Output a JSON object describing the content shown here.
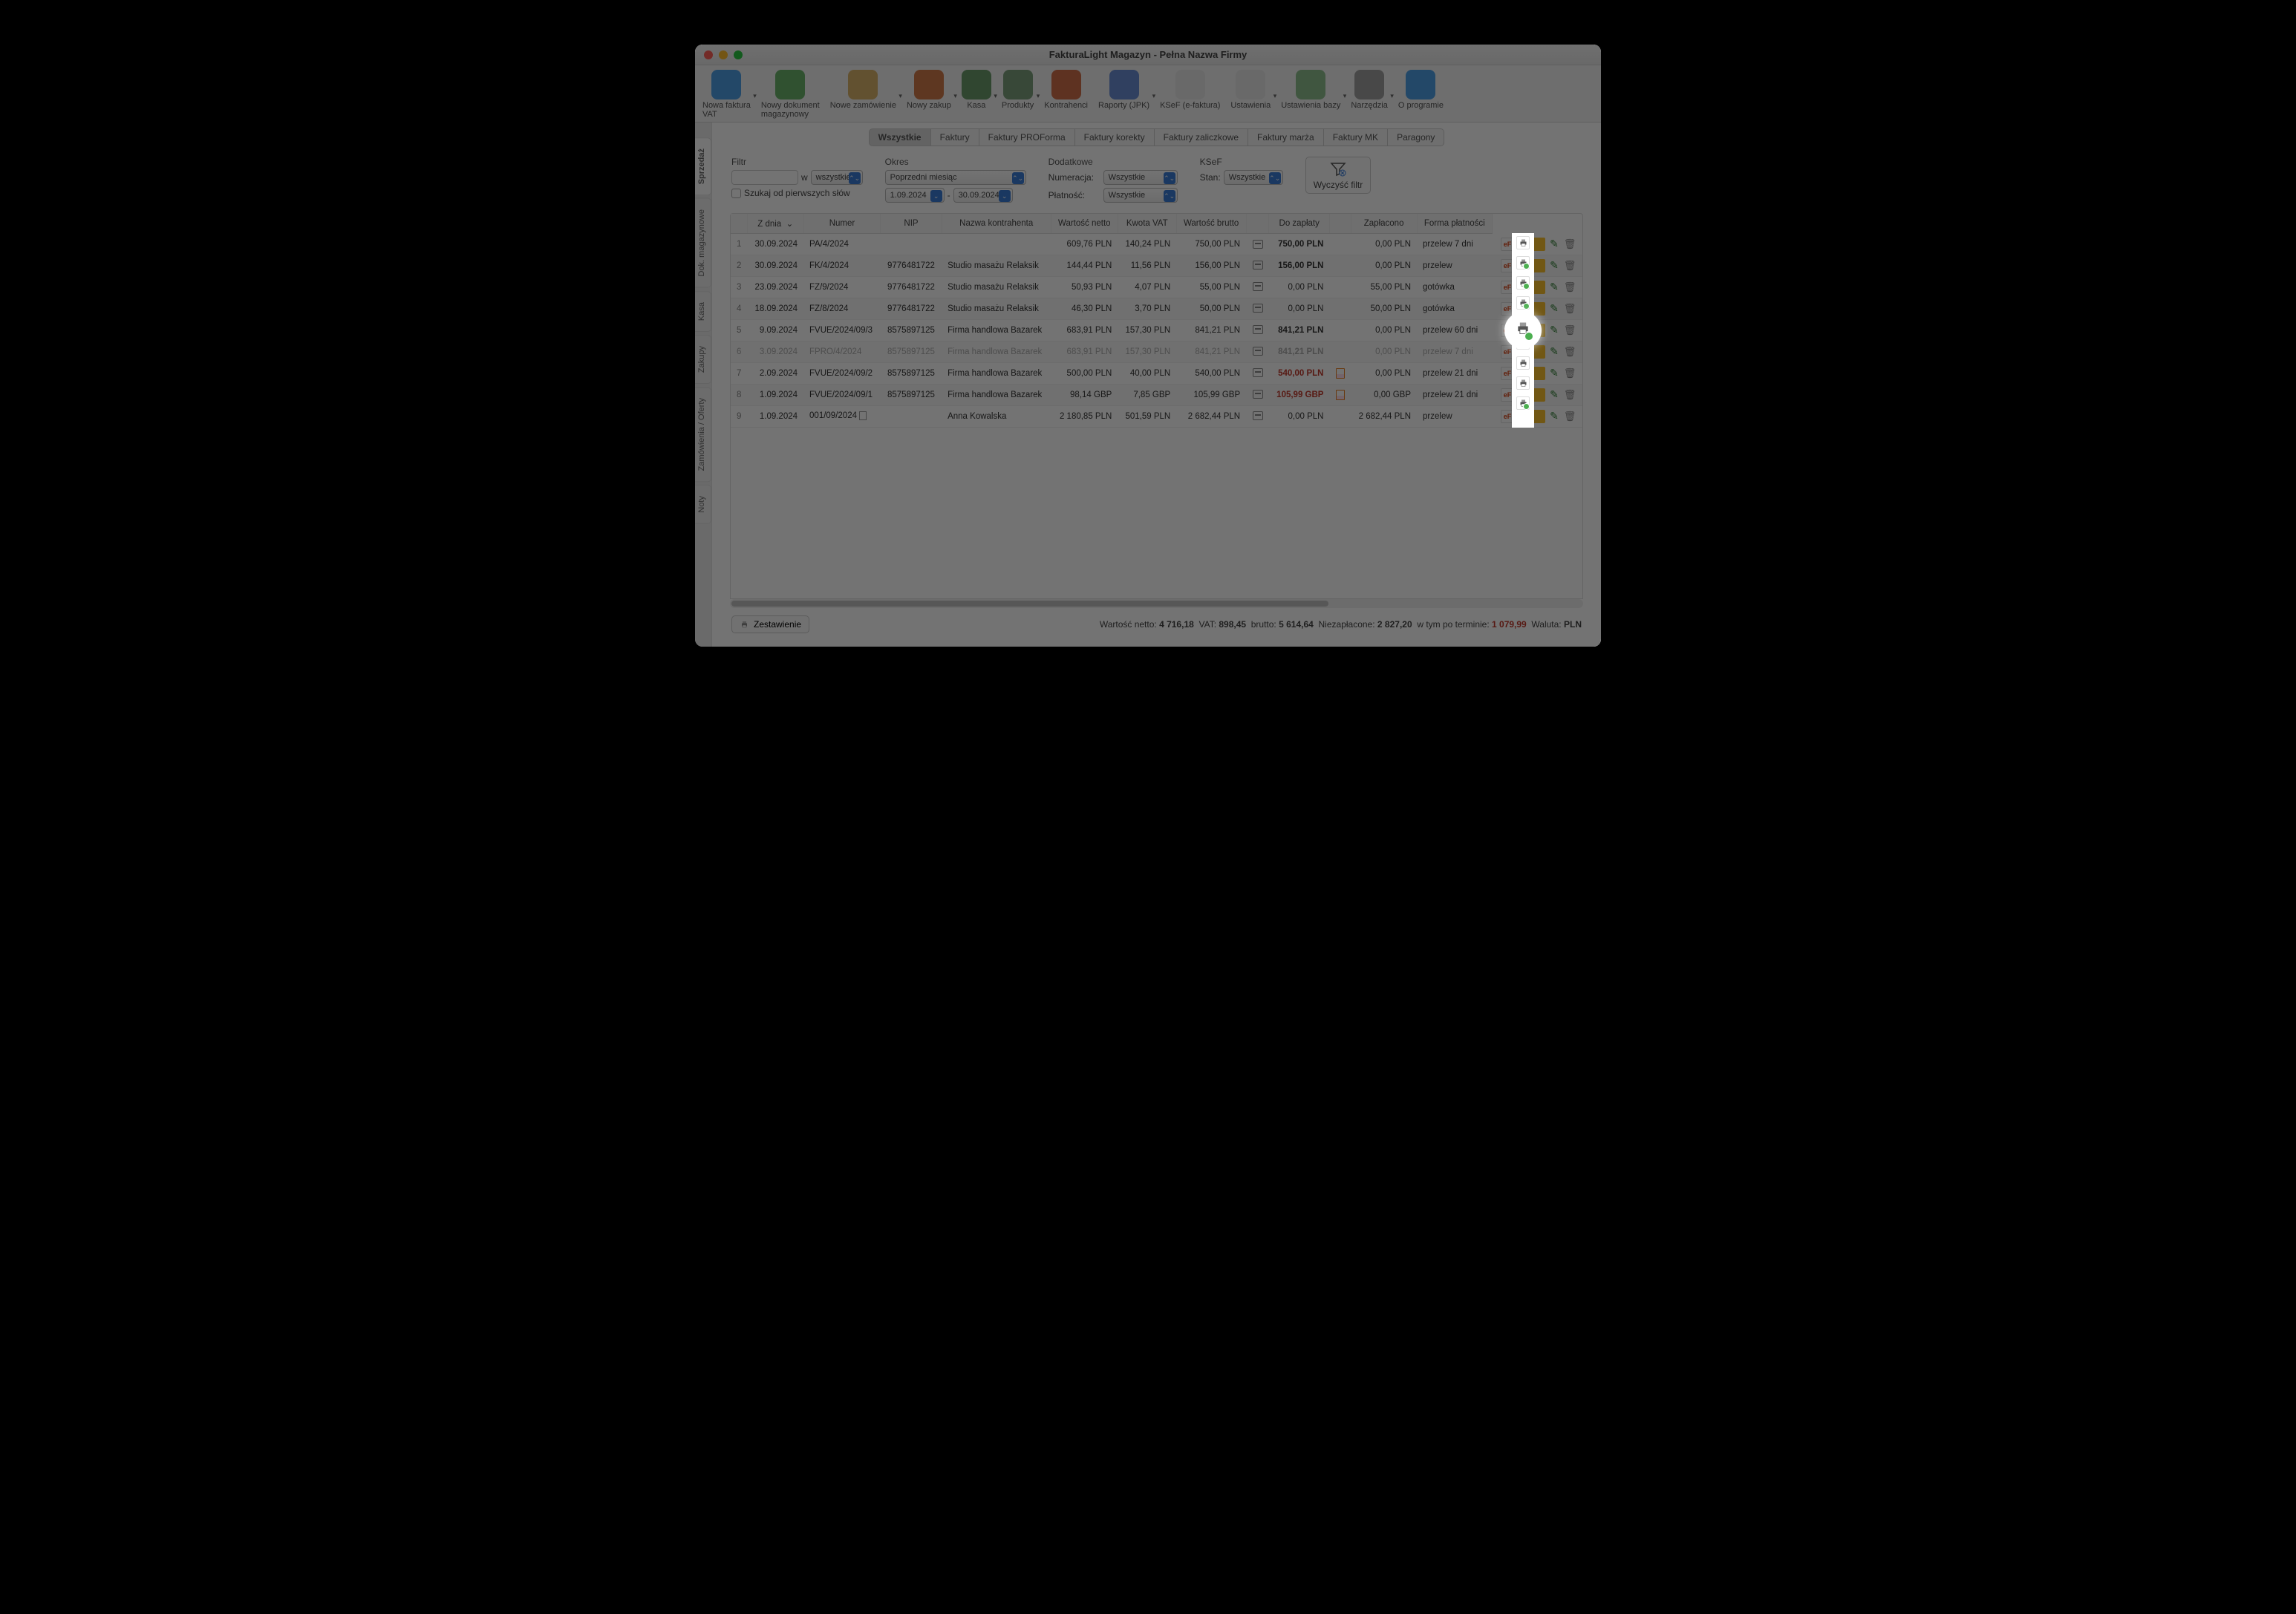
{
  "window_title": "FakturaLight Magazyn - Pełna Nazwa Firmy",
  "toolbar": [
    {
      "label": "Nowa faktura VAT",
      "icon": "#4e9fe6",
      "caret": true
    },
    {
      "label": "Nowy dokument magazynowy",
      "icon": "#6bb36b",
      "caret": false
    },
    {
      "label": "Nowe zamówienie",
      "icon": "#d9b36a",
      "caret": true
    },
    {
      "label": "Nowy zakup",
      "icon": "#d07a4a",
      "caret": true
    },
    {
      "label": "Kasa",
      "icon": "#6b9b6b",
      "caret": true
    },
    {
      "label": "Produkty",
      "icon": "#7da07d",
      "caret": true
    },
    {
      "label": "Kontrahenci",
      "icon": "#d0704a",
      "caret": false
    },
    {
      "label": "Raporty (JPK)",
      "icon": "#6b8fd6",
      "caret": true
    },
    {
      "label": "KSeF (e-faktura)",
      "icon": "#e8e8e8",
      "caret": false
    },
    {
      "label": "Ustawienia",
      "icon": "#e8e8e8",
      "caret": true
    },
    {
      "label": "Ustawienia bazy",
      "icon": "#8fbf8f",
      "caret": true
    },
    {
      "label": "Narzędzia",
      "icon": "#a0a0a0",
      "caret": true
    },
    {
      "label": "O programie",
      "icon": "#4ea0e6",
      "caret": false
    }
  ],
  "sidetabs": [
    "Sprzedaż",
    "Dok. magazynowe",
    "Kasa",
    "Zakupy",
    "Zamówienia / Oferty",
    "Noty"
  ],
  "subtabs": [
    "Wszystkie",
    "Faktury",
    "Faktury PROForma",
    "Faktury korekty",
    "Faktury zaliczkowe",
    "Faktury marża",
    "Faktury MK",
    "Paragony"
  ],
  "filters": {
    "filtr_head": "Filtr",
    "w": "w",
    "w_value": "wszystkie",
    "checkbox_label": "Szukaj od pierwszych słów",
    "okres_head": "Okres",
    "okres_value": "Poprzedni miesiąc",
    "date_from": "1.09.2024",
    "date_sep": "-",
    "date_to": "30.09.2024",
    "dodatkowe_head": "Dodatkowe",
    "numeracja_label": "Numeracja:",
    "numeracja_value": "Wszystkie",
    "platnosc_label": "Płatność:",
    "platnosc_value": "Wszystkie",
    "ksef_head": "KSeF",
    "stan_label": "Stan:",
    "stan_value": "Wszystkie",
    "clear_label": "Wyczyść filtr"
  },
  "columns": [
    "",
    "Z dnia",
    "Numer",
    "NIP",
    "Nazwa kontrahenta",
    "Wartość netto",
    "Kwota VAT",
    "Wartość brutto",
    "",
    "Do zapłaty",
    "",
    "Zapłacono",
    "Forma płatności"
  ],
  "rows": [
    {
      "n": "1",
      "date": "30.09.2024",
      "num": "PA/4/2024",
      "nip": "",
      "name": "",
      "netto": "609,76 PLN",
      "vat": "140,24 PLN",
      "brutto": "750,00 PLN",
      "pi": true,
      "due": "750,00 PLN",
      "due_style": "bold",
      "doc": false,
      "paid": "0,00 PLN",
      "method": "przelew 7 dni",
      "print_ok": false
    },
    {
      "n": "2",
      "date": "30.09.2024",
      "num": "FK/4/2024",
      "nip": "9776481722",
      "name": "Studio masażu Relaksik",
      "netto": "144,44 PLN",
      "vat": "11,56 PLN",
      "brutto": "156,00 PLN",
      "pi": true,
      "due": "156,00 PLN",
      "due_style": "bold",
      "doc": false,
      "paid": "0,00 PLN",
      "method": "przelew",
      "print_ok": true
    },
    {
      "n": "3",
      "date": "23.09.2024",
      "num": "FZ/9/2024",
      "nip": "9776481722",
      "name": "Studio masażu Relaksik",
      "netto": "50,93 PLN",
      "vat": "4,07 PLN",
      "brutto": "55,00 PLN",
      "pi": true,
      "due": "0,00 PLN",
      "due_style": "",
      "doc": false,
      "paid": "55,00 PLN",
      "method": "gotówka",
      "print_ok": true
    },
    {
      "n": "4",
      "date": "18.09.2024",
      "num": "FZ/8/2024",
      "nip": "9776481722",
      "name": "Studio masażu Relaksik",
      "netto": "46,30 PLN",
      "vat": "3,70 PLN",
      "brutto": "50,00 PLN",
      "pi": true,
      "due": "0,00 PLN",
      "due_style": "",
      "doc": false,
      "paid": "50,00 PLN",
      "method": "gotówka",
      "print_ok": true
    },
    {
      "n": "5",
      "date": "9.09.2024",
      "num": "FVUE/2024/09/3",
      "nip": "8575897125",
      "name": "Firma handlowa Bazarek",
      "netto": "683,91 PLN",
      "vat": "157,30 PLN",
      "brutto": "841,21 PLN",
      "pi": true,
      "due": "841,21 PLN",
      "due_style": "bold",
      "doc": false,
      "paid": "0,00 PLN",
      "method": "przelew 60 dni",
      "print_ok": true,
      "highlight": true
    },
    {
      "n": "6",
      "date": "3.09.2024",
      "num": "FPRO/4/2024",
      "nip": "8575897125",
      "name": "Firma handlowa Bazarek",
      "netto": "683,91 PLN",
      "vat": "157,30 PLN",
      "brutto": "841,21 PLN",
      "pi": true,
      "due": "841,21 PLN",
      "due_style": "red",
      "doc": false,
      "paid": "0,00 PLN",
      "method": "przelew 7 dni",
      "dim": true,
      "print_ok": false
    },
    {
      "n": "7",
      "date": "2.09.2024",
      "num": "FVUE/2024/09/2",
      "nip": "8575897125",
      "name": "Firma handlowa Bazarek",
      "netto": "500,00 PLN",
      "vat": "40,00 PLN",
      "brutto": "540,00 PLN",
      "pi": true,
      "due": "540,00 PLN",
      "due_style": "red",
      "doc": true,
      "paid": "0,00 PLN",
      "method": "przelew 21 dni",
      "print_ok": false
    },
    {
      "n": "8",
      "date": "1.09.2024",
      "num": "FVUE/2024/09/1",
      "nip": "8575897125",
      "name": "Firma handlowa Bazarek",
      "netto": "98,14 GBP",
      "vat": "7,85 GBP",
      "brutto": "105,99 GBP",
      "pi": true,
      "due": "105,99 GBP",
      "due_style": "red",
      "doc": true,
      "paid": "0,00 GBP",
      "method": "przelew 21 dni",
      "print_ok": false
    },
    {
      "n": "9",
      "date": "1.09.2024",
      "num": "001/09/2024",
      "nip": "",
      "name": "Anna Kowalska",
      "netto": "2 180,85 PLN",
      "vat": "501,59 PLN",
      "brutto": "2 682,44 PLN",
      "pi": true,
      "due": "0,00 PLN",
      "due_style": "",
      "doc": false,
      "paid": "2 682,44 PLN",
      "method": "przelew",
      "note": true,
      "print_ok": true
    }
  ],
  "footer": {
    "zest": "Zestawienie",
    "netto_l": "Wartość netto:",
    "netto_v": "4 716,18",
    "vat_l": "VAT:",
    "vat_v": "898,45",
    "brutto_l": "brutto:",
    "brutto_v": "5 614,64",
    "niez_l": "Niezapłacone:",
    "niez_v": "2 827,20",
    "term_l": "w tym po terminie:",
    "term_v": "1 079,99",
    "wal_l": "Waluta:",
    "wal_v": "PLN"
  }
}
